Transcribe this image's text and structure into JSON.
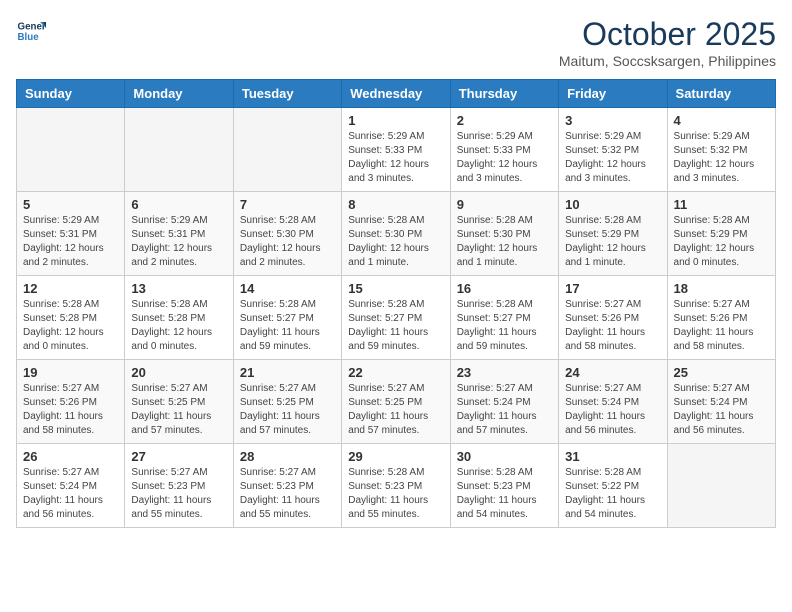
{
  "logo": {
    "line1": "General",
    "line2": "Blue"
  },
  "title": "October 2025",
  "subtitle": "Maitum, Soccsksargen, Philippines",
  "headers": [
    "Sunday",
    "Monday",
    "Tuesday",
    "Wednesday",
    "Thursday",
    "Friday",
    "Saturday"
  ],
  "weeks": [
    [
      {
        "day": "",
        "info": ""
      },
      {
        "day": "",
        "info": ""
      },
      {
        "day": "",
        "info": ""
      },
      {
        "day": "1",
        "info": "Sunrise: 5:29 AM\nSunset: 5:33 PM\nDaylight: 12 hours\nand 3 minutes."
      },
      {
        "day": "2",
        "info": "Sunrise: 5:29 AM\nSunset: 5:33 PM\nDaylight: 12 hours\nand 3 minutes."
      },
      {
        "day": "3",
        "info": "Sunrise: 5:29 AM\nSunset: 5:32 PM\nDaylight: 12 hours\nand 3 minutes."
      },
      {
        "day": "4",
        "info": "Sunrise: 5:29 AM\nSunset: 5:32 PM\nDaylight: 12 hours\nand 3 minutes."
      }
    ],
    [
      {
        "day": "5",
        "info": "Sunrise: 5:29 AM\nSunset: 5:31 PM\nDaylight: 12 hours\nand 2 minutes."
      },
      {
        "day": "6",
        "info": "Sunrise: 5:29 AM\nSunset: 5:31 PM\nDaylight: 12 hours\nand 2 minutes."
      },
      {
        "day": "7",
        "info": "Sunrise: 5:28 AM\nSunset: 5:30 PM\nDaylight: 12 hours\nand 2 minutes."
      },
      {
        "day": "8",
        "info": "Sunrise: 5:28 AM\nSunset: 5:30 PM\nDaylight: 12 hours\nand 1 minute."
      },
      {
        "day": "9",
        "info": "Sunrise: 5:28 AM\nSunset: 5:30 PM\nDaylight: 12 hours\nand 1 minute."
      },
      {
        "day": "10",
        "info": "Sunrise: 5:28 AM\nSunset: 5:29 PM\nDaylight: 12 hours\nand 1 minute."
      },
      {
        "day": "11",
        "info": "Sunrise: 5:28 AM\nSunset: 5:29 PM\nDaylight: 12 hours\nand 0 minutes."
      }
    ],
    [
      {
        "day": "12",
        "info": "Sunrise: 5:28 AM\nSunset: 5:28 PM\nDaylight: 12 hours\nand 0 minutes."
      },
      {
        "day": "13",
        "info": "Sunrise: 5:28 AM\nSunset: 5:28 PM\nDaylight: 12 hours\nand 0 minutes."
      },
      {
        "day": "14",
        "info": "Sunrise: 5:28 AM\nSunset: 5:27 PM\nDaylight: 11 hours\nand 59 minutes."
      },
      {
        "day": "15",
        "info": "Sunrise: 5:28 AM\nSunset: 5:27 PM\nDaylight: 11 hours\nand 59 minutes."
      },
      {
        "day": "16",
        "info": "Sunrise: 5:28 AM\nSunset: 5:27 PM\nDaylight: 11 hours\nand 59 minutes."
      },
      {
        "day": "17",
        "info": "Sunrise: 5:27 AM\nSunset: 5:26 PM\nDaylight: 11 hours\nand 58 minutes."
      },
      {
        "day": "18",
        "info": "Sunrise: 5:27 AM\nSunset: 5:26 PM\nDaylight: 11 hours\nand 58 minutes."
      }
    ],
    [
      {
        "day": "19",
        "info": "Sunrise: 5:27 AM\nSunset: 5:26 PM\nDaylight: 11 hours\nand 58 minutes."
      },
      {
        "day": "20",
        "info": "Sunrise: 5:27 AM\nSunset: 5:25 PM\nDaylight: 11 hours\nand 57 minutes."
      },
      {
        "day": "21",
        "info": "Sunrise: 5:27 AM\nSunset: 5:25 PM\nDaylight: 11 hours\nand 57 minutes."
      },
      {
        "day": "22",
        "info": "Sunrise: 5:27 AM\nSunset: 5:25 PM\nDaylight: 11 hours\nand 57 minutes."
      },
      {
        "day": "23",
        "info": "Sunrise: 5:27 AM\nSunset: 5:24 PM\nDaylight: 11 hours\nand 57 minutes."
      },
      {
        "day": "24",
        "info": "Sunrise: 5:27 AM\nSunset: 5:24 PM\nDaylight: 11 hours\nand 56 minutes."
      },
      {
        "day": "25",
        "info": "Sunrise: 5:27 AM\nSunset: 5:24 PM\nDaylight: 11 hours\nand 56 minutes."
      }
    ],
    [
      {
        "day": "26",
        "info": "Sunrise: 5:27 AM\nSunset: 5:24 PM\nDaylight: 11 hours\nand 56 minutes."
      },
      {
        "day": "27",
        "info": "Sunrise: 5:27 AM\nSunset: 5:23 PM\nDaylight: 11 hours\nand 55 minutes."
      },
      {
        "day": "28",
        "info": "Sunrise: 5:27 AM\nSunset: 5:23 PM\nDaylight: 11 hours\nand 55 minutes."
      },
      {
        "day": "29",
        "info": "Sunrise: 5:28 AM\nSunset: 5:23 PM\nDaylight: 11 hours\nand 55 minutes."
      },
      {
        "day": "30",
        "info": "Sunrise: 5:28 AM\nSunset: 5:23 PM\nDaylight: 11 hours\nand 54 minutes."
      },
      {
        "day": "31",
        "info": "Sunrise: 5:28 AM\nSunset: 5:22 PM\nDaylight: 11 hours\nand 54 minutes."
      },
      {
        "day": "",
        "info": ""
      }
    ]
  ]
}
